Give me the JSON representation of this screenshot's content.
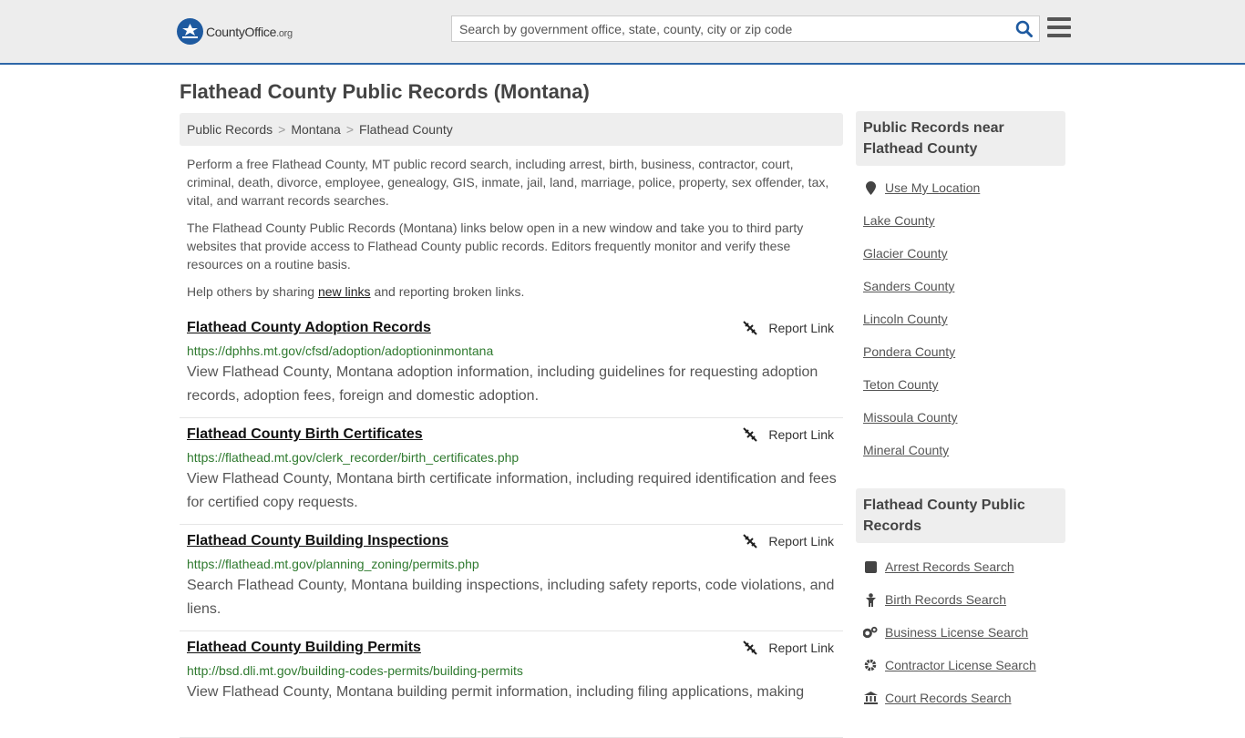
{
  "header": {
    "logo_text": "CountyOffice",
    "logo_suffix": ".org",
    "search_placeholder": "Search by government office, state, county, city or zip code",
    "search_value": ""
  },
  "page": {
    "title": "Flathead County Public Records (Montana)",
    "breadcrumb": [
      "Public Records",
      "Montana",
      "Flathead County"
    ],
    "breadcrumb_sep": ">",
    "intro1": "Perform a free Flathead County, MT public record search, including arrest, birth, business, contractor, court, criminal, death, divorce, employee, genealogy, GIS, inmate, jail, land, marriage, police, property, sex offender, tax, vital, and warrant records searches.",
    "intro2": "The Flathead County Public Records (Montana) links below open in a new window and take you to third party websites that provide access to Flathead County public records. Editors frequently monitor and verify these resources on a routine basis.",
    "help_prefix": "Help others by sharing ",
    "help_link": "new links",
    "help_suffix": " and reporting broken links."
  },
  "records": [
    {
      "title": "Flathead County Adoption Records",
      "url": "https://dphhs.mt.gov/cfsd/adoption/adoptioninmontana",
      "desc": "View Flathead County, Montana adoption information, including guidelines for requesting adoption records, adoption fees, foreign and domestic adoption.",
      "report": "Report Link"
    },
    {
      "title": "Flathead County Birth Certificates",
      "url": "https://flathead.mt.gov/clerk_recorder/birth_certificates.php",
      "desc": "View Flathead County, Montana birth certificate information, including required identification and fees for certified copy requests.",
      "report": "Report Link"
    },
    {
      "title": "Flathead County Building Inspections",
      "url": "https://flathead.mt.gov/planning_zoning/permits.php",
      "desc": "Search Flathead County, Montana building inspections, including safety reports, code violations, and liens.",
      "report": "Report Link"
    },
    {
      "title": "Flathead County Building Permits",
      "url": "http://bsd.dli.mt.gov/building-codes-permits/building-permits",
      "desc": "View Flathead County, Montana building permit information, including filing applications, making",
      "report": "Report Link"
    }
  ],
  "sidebar": {
    "nearby_heading": "Public Records near Flathead County",
    "use_location": "Use My Location",
    "nearby": [
      "Lake County",
      "Glacier County",
      "Sanders County",
      "Lincoln County",
      "Pondera County",
      "Teton County",
      "Missoula County",
      "Mineral County"
    ],
    "records_heading": "Flathead County Public Records",
    "record_links": [
      {
        "label": "Arrest Records Search",
        "icon": "square-icon"
      },
      {
        "label": "Birth Records Search",
        "icon": "baby-icon"
      },
      {
        "label": "Business License Search",
        "icon": "gears-icon"
      },
      {
        "label": "Contractor License Search",
        "icon": "gear-icon"
      },
      {
        "label": "Court Records Search",
        "icon": "courthouse-icon"
      }
    ]
  }
}
